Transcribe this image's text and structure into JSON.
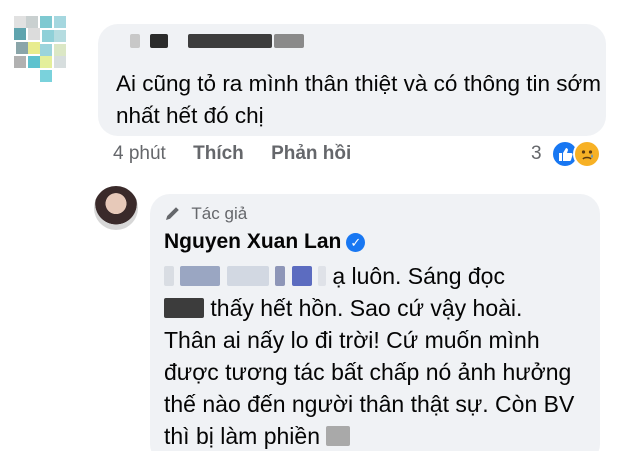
{
  "first_comment": {
    "text": "Ai cũng tỏ ra mình thân thiệt và có thông tin sớm nhất hết đó chị",
    "actions": {
      "time": "4 phút",
      "like": "Thích",
      "reply": "Phản hồi"
    },
    "reaction_count": "3",
    "reaction_icons": [
      "like-icon",
      "sad-face-icon"
    ]
  },
  "reply": {
    "author_badge": "Tác giả",
    "author_name": "Nguyen Xuan Lan",
    "verified_icon": "verified-badge-icon",
    "line1": "ạ luôn. Sáng đọc",
    "line2": "thấy hết hồn. Sao cứ vậy hoài.",
    "line3": "Thân ai nấy lo đi trời! Cứ muốn mình được tương tác bất chấp nó ảnh hưởng thế nào đến người thân thật sự. Còn BV thì bị làm phiền"
  },
  "colors": {
    "bubble": "#f0f2f5",
    "secondary_text": "#65676b",
    "facebook_blue": "#1877f2"
  }
}
